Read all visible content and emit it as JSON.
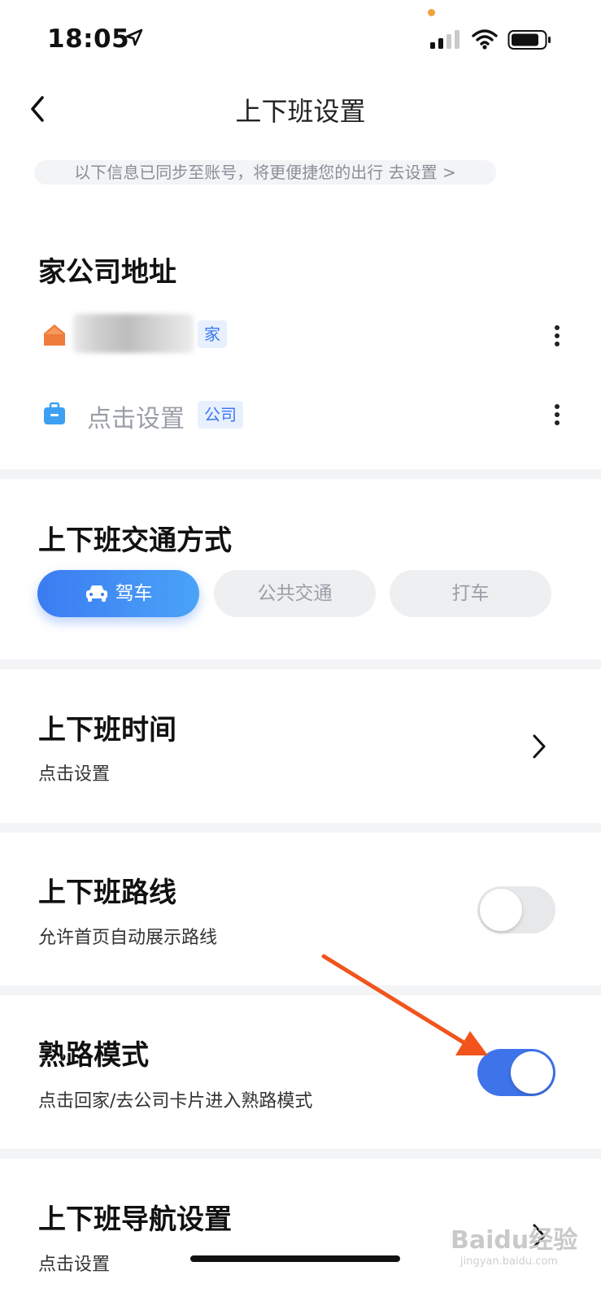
{
  "status_bar": {
    "time": "18:05"
  },
  "header": {
    "title": "上下班设置"
  },
  "sync_notice": "以下信息已同步至账号，将更便捷您的出行 去设置 >",
  "address_section": {
    "title": "家公司地址",
    "home": {
      "tag": "家"
    },
    "company": {
      "placeholder": "点击设置",
      "tag": "公司"
    }
  },
  "transport_section": {
    "title": "上下班交通方式",
    "options": [
      "驾车",
      "公共交通",
      "打车"
    ],
    "selected": "驾车"
  },
  "time_section": {
    "title": "上下班时间",
    "subtitle": "点击设置"
  },
  "route_section": {
    "title": "上下班路线",
    "subtitle": "允许首页自动展示路线",
    "enabled": false
  },
  "familiar_section": {
    "title": "熟路模式",
    "subtitle": "点击回家/去公司卡片进入熟路模式",
    "enabled": true
  },
  "nav_section": {
    "title": "上下班导航设置",
    "subtitle": "点击设置"
  },
  "watermark": {
    "main": "Baidu经验",
    "sub": "jingyan.baidu.com"
  },
  "colors": {
    "accent": "#3f73ea",
    "home_icon": "#f07c3a",
    "company_icon": "#3ea0f2",
    "annotation": "#f2541c"
  }
}
